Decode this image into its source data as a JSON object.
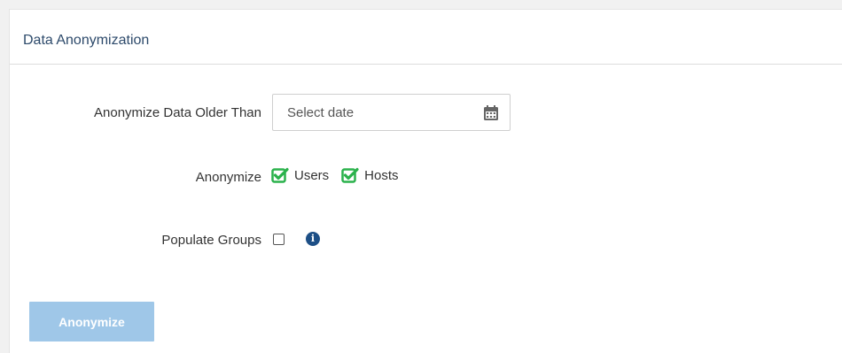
{
  "panel": {
    "title": "Data Anonymization"
  },
  "form": {
    "date": {
      "label": "Anonymize Data Older Than",
      "placeholder": "Select date",
      "icon": "calendar-icon"
    },
    "anonymize": {
      "label": "Anonymize",
      "options": [
        {
          "label": "Users",
          "checked": true
        },
        {
          "label": "Hosts",
          "checked": true
        }
      ],
      "check_color": "#2bb24c"
    },
    "populate_groups": {
      "label": "Populate Groups",
      "checked": false,
      "info_icon": "info-icon"
    },
    "submit_label": "Anonymize",
    "submit_color": "#9fc7e8"
  }
}
